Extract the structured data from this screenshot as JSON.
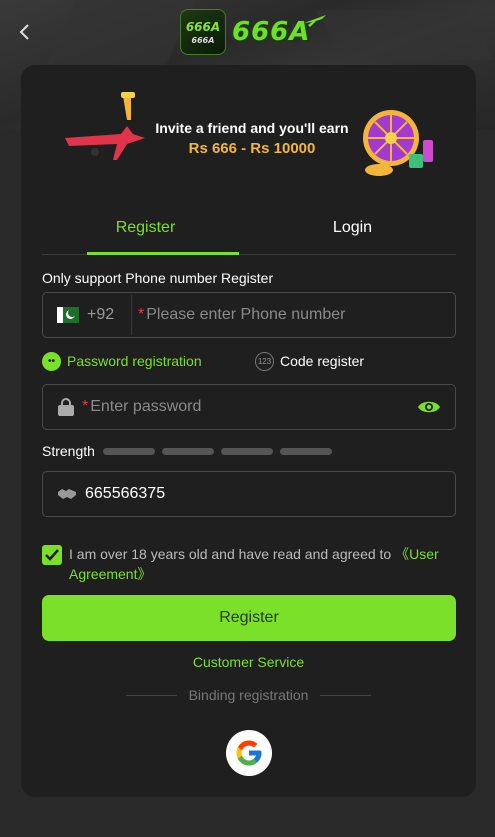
{
  "header": {
    "logo_badge_top": "666A",
    "logo_badge_bottom": "666A",
    "logo_text": "666A"
  },
  "banner": {
    "line1": "Invite a friend and you'll earn",
    "line2": "Rs 666 - Rs 10000"
  },
  "tabs": [
    {
      "label": "Register",
      "active": true
    },
    {
      "label": "Login",
      "active": false
    }
  ],
  "form": {
    "phone_label": "Only support Phone number Register",
    "country_code": "+92",
    "phone_required_mark": "*",
    "phone_placeholder": "Please enter Phone number",
    "mode_password_label": "Password registration",
    "mode_code_label": "Code register",
    "mode_code_icon_text": "123",
    "password_required_mark": "*",
    "password_placeholder": "Enter password",
    "strength_label": "Strength",
    "invite_code": "665566375",
    "agreement_text": "I am over 18 years old and have read and agreed to ",
    "agreement_link": "《User Agreement》",
    "register_button": "Register"
  },
  "footer": {
    "customer_service": "Customer Service",
    "binding_label": "Binding registration"
  },
  "colors": {
    "accent": "#7ae02a",
    "card_bg": "#1f1f1f",
    "page_bg": "#2a2a2a",
    "banner_gold": "#f3b63a"
  }
}
